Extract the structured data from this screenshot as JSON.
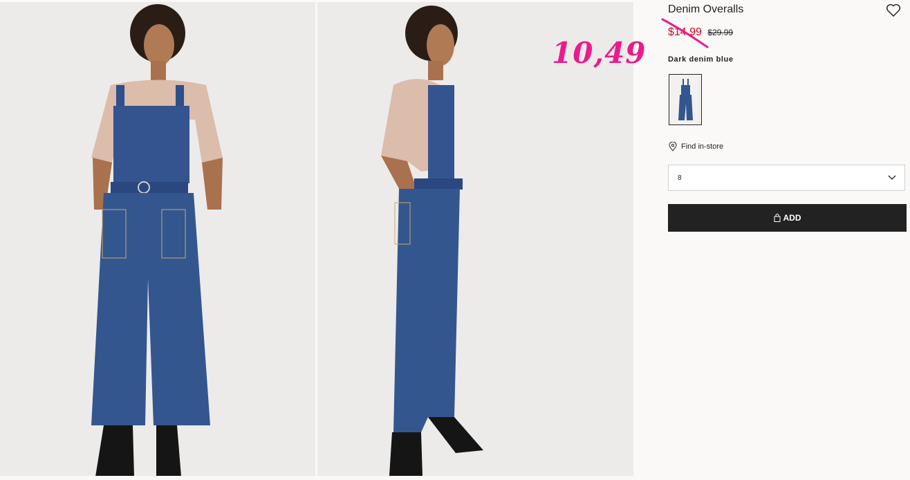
{
  "product": {
    "title": "Denim Overalls",
    "sale_price": "$14.99",
    "original_price": "$29.99",
    "color_label": "Dark denim blue",
    "find_in_store": "Find in-store",
    "selected_size": "8",
    "add_button_label": "ADD"
  },
  "annotation": {
    "handwritten_price": "10,49"
  },
  "icons": {
    "favorite": "heart-icon",
    "store": "location-pin-icon",
    "dropdown": "chevron-down-icon",
    "bag": "shopping-bag-icon"
  },
  "colors": {
    "sale": "#d6001c",
    "annotation": "#ec1a8c",
    "button": "#222222",
    "denim": "#2f4f8a"
  }
}
